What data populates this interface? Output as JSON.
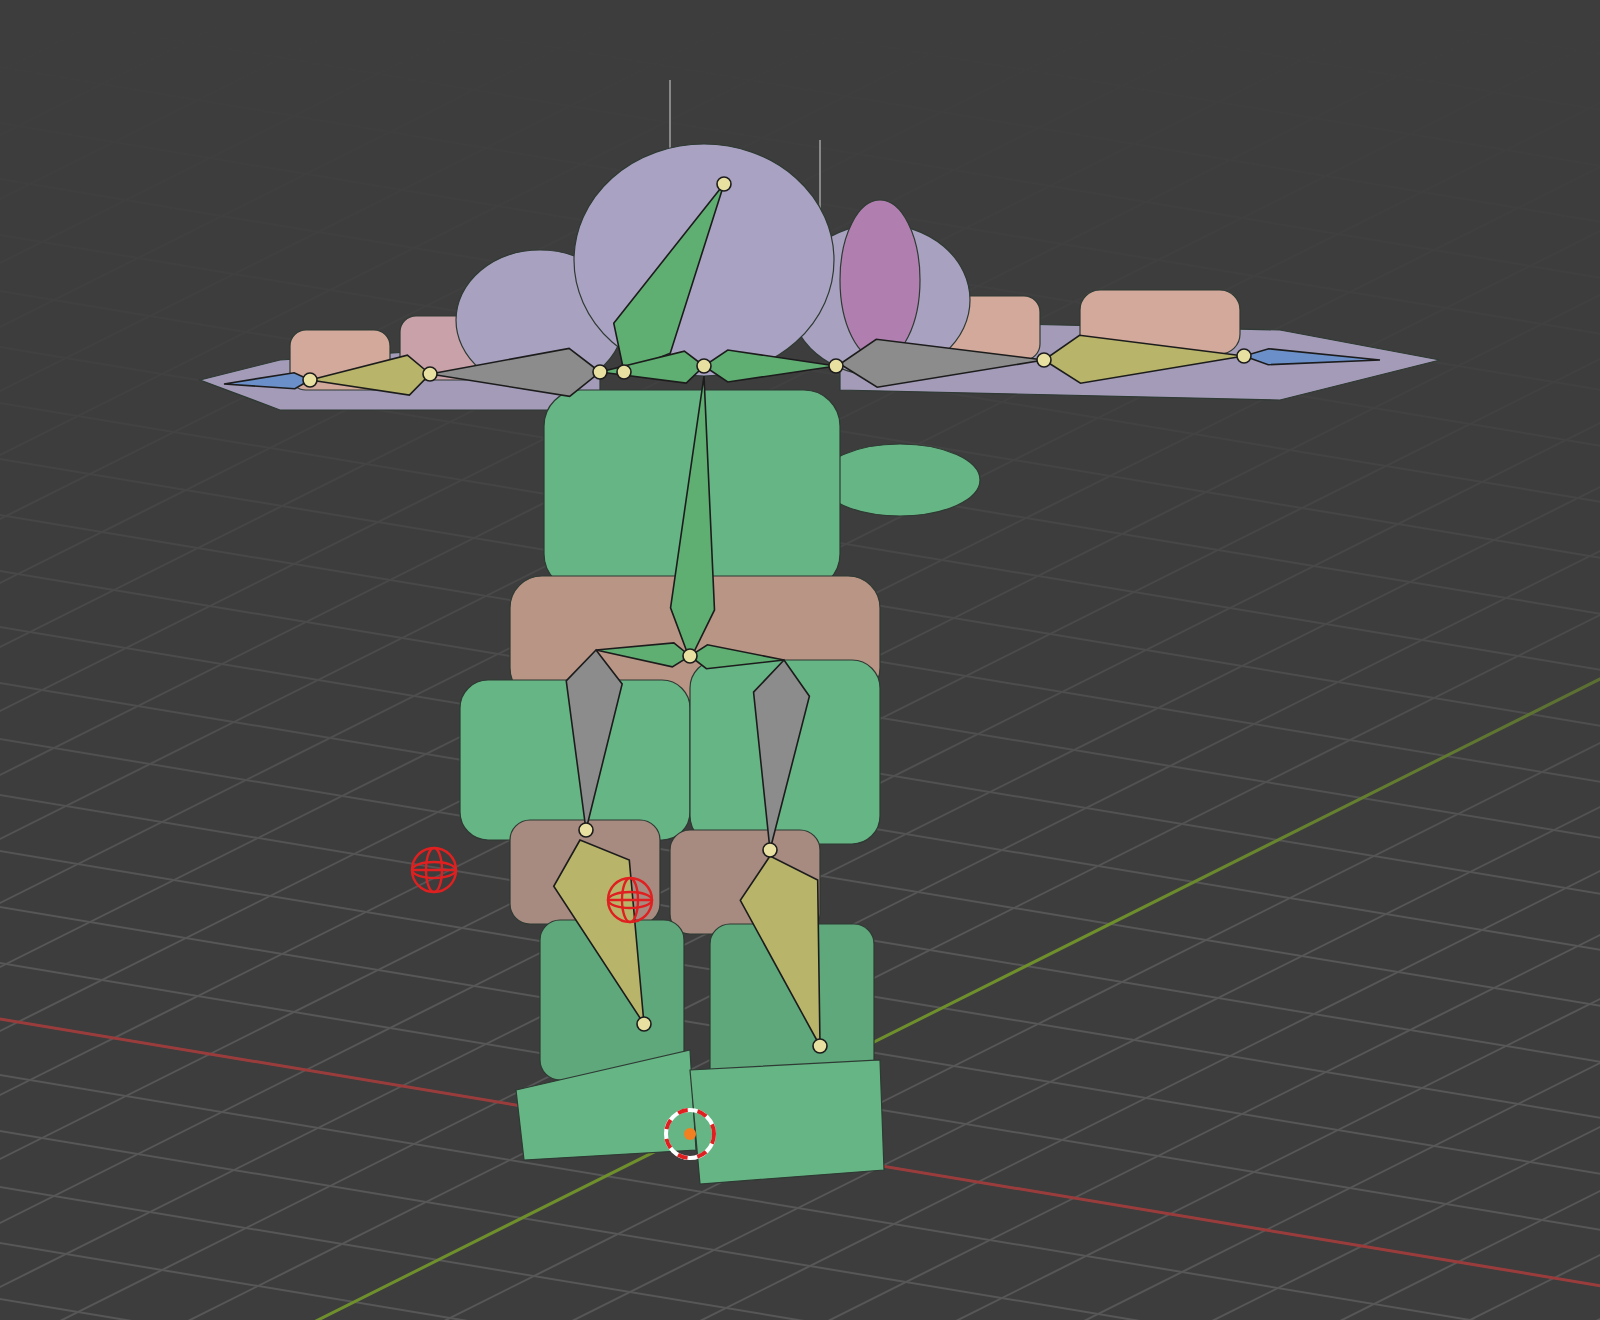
{
  "viewport": {
    "show_grid": true,
    "show_axes": true,
    "show_model": true,
    "show_armature": true,
    "show_cursor": true,
    "empties": [
      {
        "kind": "sphere"
      },
      {
        "kind": "sphere"
      }
    ]
  }
}
